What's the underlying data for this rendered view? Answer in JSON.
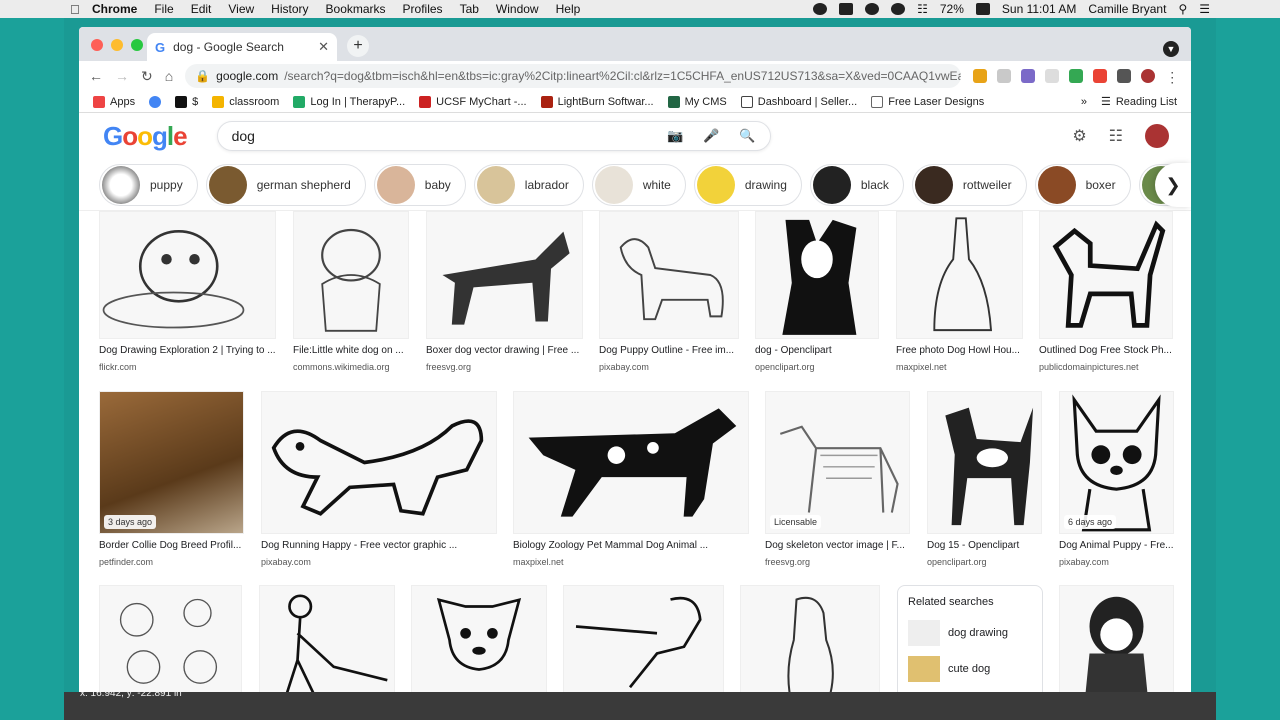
{
  "menubar": {
    "app": "Chrome",
    "menus": [
      "File",
      "Edit",
      "View",
      "History",
      "Bookmarks",
      "Profiles",
      "Tab",
      "Window",
      "Help"
    ],
    "battery": "72%",
    "clock": "Sun 11:01 AM",
    "user": "Camille Bryant"
  },
  "browser": {
    "tab_title": "dog - Google Search",
    "url_host": "google.com",
    "url_rest": "/search?q=dog&tbm=isch&hl=en&tbs=ic:gray%2Citp:lineart%2Cil:cl&rlz=1C5CHFA_enUS712US713&sa=X&ved=0CAAQ1vwEa...",
    "bookmarks": [
      "Apps",
      "$",
      "classroom",
      "Log In | TherapyP...",
      "UCSF MyChart -...",
      "LightBurn Softwar...",
      "My CMS",
      "Dashboard | Seller...",
      "Free Laser Designs"
    ],
    "more": "»",
    "reading_list": "Reading List"
  },
  "search": {
    "query": "dog"
  },
  "chips": [
    "puppy",
    "german shepherd",
    "baby",
    "labrador",
    "white",
    "drawing",
    "black",
    "rottweiler",
    "boxer"
  ],
  "results": [
    {
      "caption": "Dog Drawing Exploration 2 | Trying to ...",
      "source": "flickr.com"
    },
    {
      "caption": "File:Little white dog on ...",
      "source": "commons.wikimedia.org"
    },
    {
      "caption": "Boxer dog vector drawing | Free ...",
      "source": "freesvg.org"
    },
    {
      "caption": "Dog Puppy Outline - Free im...",
      "source": "pixabay.com"
    },
    {
      "caption": "dog - Openclipart",
      "source": "openclipart.org"
    },
    {
      "caption": "Free photo Dog Howl Hou...",
      "source": "maxpixel.net"
    },
    {
      "caption": "Outlined Dog Free Stock Ph...",
      "source": "publicdomainpictures.net"
    },
    {
      "caption": "Border Collie Dog Breed Profil...",
      "source": "petfinder.com",
      "badge": "3 days ago"
    },
    {
      "caption": "Dog Running Happy - Free vector graphic ...",
      "source": "pixabay.com"
    },
    {
      "caption": "Biology Zoology Pet Mammal Dog Animal ...",
      "source": "maxpixel.net"
    },
    {
      "caption": "Dog skeleton vector image | F...",
      "source": "freesvg.org",
      "badge": "Licensable"
    },
    {
      "caption": "Dog 15 - Openclipart",
      "source": "openclipart.org"
    },
    {
      "caption": "Dog Animal Puppy - Fre...",
      "source": "pixabay.com",
      "badge": "6 days ago"
    }
  ],
  "related": {
    "title": "Related searches",
    "items": [
      "dog drawing",
      "cute dog"
    ]
  },
  "coords_readout": "x: 16.942, y: -22.891 in"
}
